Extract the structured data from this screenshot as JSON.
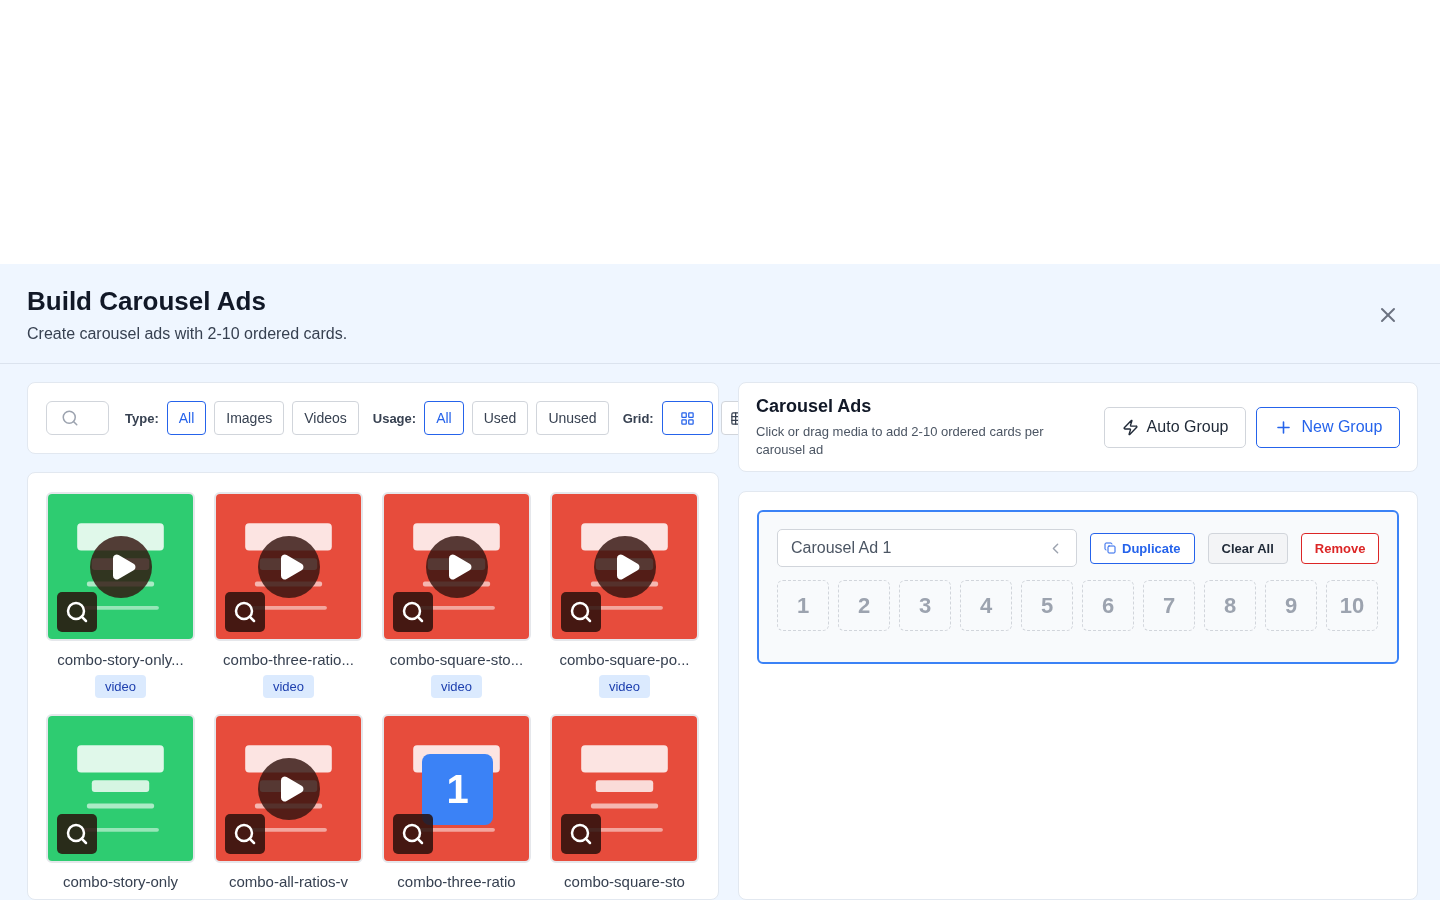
{
  "header": {
    "title": "Build Carousel Ads",
    "subtitle": "Create carousel ads with 2-10 ordered cards."
  },
  "filters": {
    "type_label": "Type:",
    "type_options": [
      {
        "label": "All",
        "selected": true
      },
      {
        "label": "Images",
        "selected": false
      },
      {
        "label": "Videos",
        "selected": false
      }
    ],
    "usage_label": "Usage:",
    "usage_options": [
      {
        "label": "All",
        "selected": true
      },
      {
        "label": "Used",
        "selected": false
      },
      {
        "label": "Unused",
        "selected": false
      }
    ],
    "grid_label": "Grid:",
    "grid_options": [
      {
        "kind": "large",
        "selected": true
      },
      {
        "kind": "small",
        "selected": false
      }
    ]
  },
  "media": [
    {
      "name": "combo-story-only...",
      "kind": "video",
      "tag": "video",
      "color": "#2ecc71"
    },
    {
      "name": "combo-three-ratio...",
      "kind": "video",
      "tag": "video",
      "color": "#e74c3c"
    },
    {
      "name": "combo-square-sto...",
      "kind": "video",
      "tag": "video",
      "color": "#e74c3c"
    },
    {
      "name": "combo-square-po...",
      "kind": "video",
      "tag": "video",
      "color": "#e74c3c"
    },
    {
      "name": "combo-story-only",
      "color": "#2ecc71"
    },
    {
      "name": "combo-all-ratios-v",
      "kind": "video",
      "color": "#e74c3c"
    },
    {
      "name": "combo-three-ratio",
      "badge": "1",
      "color": "#e74c3c"
    },
    {
      "name": "combo-square-sto",
      "color": "#e74c3c"
    }
  ],
  "carousel": {
    "title": "Carousel Ads",
    "description": "Click or drag media to add 2-10 ordered cards per carousel ad",
    "buttons": [
      "Auto Group",
      "New Group"
    ],
    "groups": [
      {
        "name": "Carousel Ad 1",
        "selected": true,
        "actions": [
          "Duplicate",
          "Clear All",
          "Remove"
        ],
        "slots": [
          "1",
          "2",
          "3",
          "4",
          "5",
          "6",
          "7",
          "8",
          "9",
          "10"
        ]
      }
    ]
  }
}
